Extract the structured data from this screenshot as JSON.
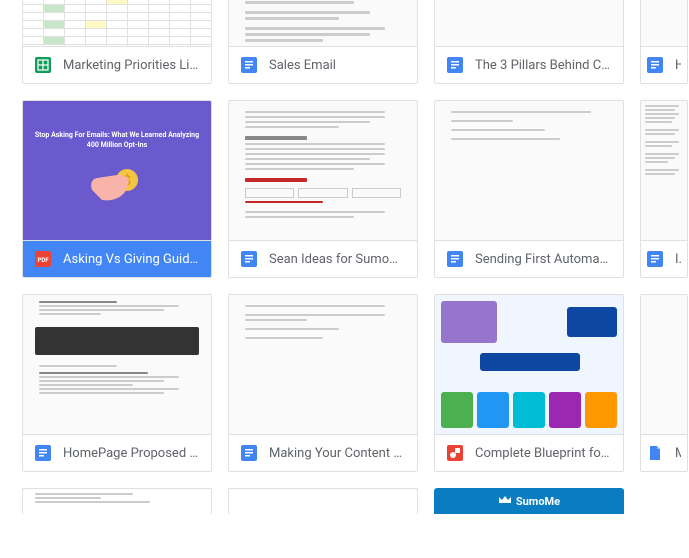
{
  "files": [
    {
      "id": 0,
      "type": "sheets",
      "title": "Marketing Priorities List"
    },
    {
      "id": 1,
      "type": "docs",
      "title": "Sales Email"
    },
    {
      "id": 2,
      "type": "docs",
      "title": "The 3 Pillars Behind Co..."
    },
    {
      "id": 3,
      "type": "docs",
      "title": "Ho"
    },
    {
      "id": 4,
      "type": "pdf",
      "title": "Asking Vs Giving Guide...",
      "selected": true,
      "cover_text": "Stop Asking For Emails: What We Learned Analyzing 400 Million Opt-Ins"
    },
    {
      "id": 5,
      "type": "docs",
      "title": "Sean Ideas for SumoM..."
    },
    {
      "id": 6,
      "type": "docs",
      "title": "Sending First Automate..."
    },
    {
      "id": 7,
      "type": "docs",
      "title": "Id"
    },
    {
      "id": 8,
      "type": "docs",
      "title": "HomePage Proposed L..."
    },
    {
      "id": 9,
      "type": "docs",
      "title": "Making Your Content W..."
    },
    {
      "id": 10,
      "type": "draw",
      "title": "Complete Blueprint for ..."
    },
    {
      "id": 11,
      "type": "docs",
      "title": "M"
    }
  ],
  "badge": {
    "label": "SumoMe"
  },
  "colors": {
    "docs": "#4285f4",
    "sheets": "#0f9d58",
    "pdf": "#ea4335",
    "draw": "#ea4335",
    "selected": "#4285f4"
  }
}
